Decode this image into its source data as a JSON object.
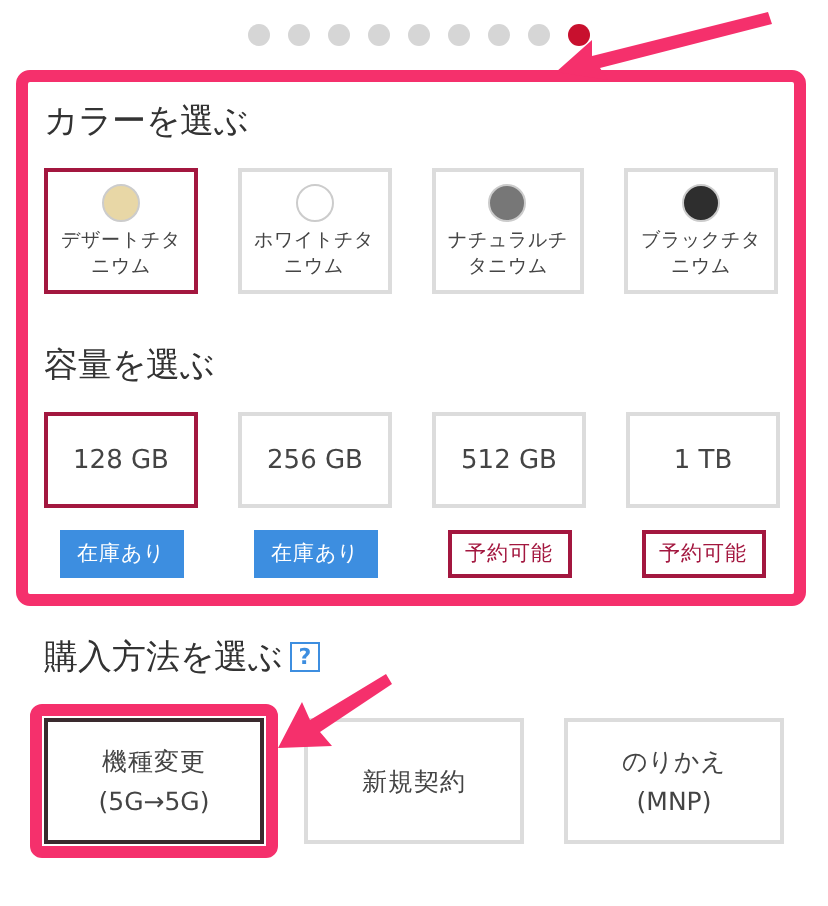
{
  "pager": [
    {
      "selected": false
    },
    {
      "selected": false
    },
    {
      "selected": false
    },
    {
      "selected": false
    },
    {
      "selected": false
    },
    {
      "selected": false
    },
    {
      "selected": false
    },
    {
      "selected": false
    },
    {
      "selected": true
    }
  ],
  "color_section": {
    "title": "カラーを選ぶ",
    "highlighted": true,
    "options": [
      {
        "label": "デザートチタニウム",
        "color": "#e8d7a6",
        "selected": true
      },
      {
        "label": "ホワイトチタニウム",
        "color": "#ffffff",
        "selected": false
      },
      {
        "label": "ナチュラルチタニウム",
        "color": "#777777",
        "selected": false
      },
      {
        "label": "ブラックチタニウム",
        "color": "#2e2e2e",
        "selected": false
      }
    ]
  },
  "capacity_section": {
    "title": "容量を選ぶ",
    "options": [
      {
        "label": "128 GB",
        "selected": true,
        "stock": {
          "kind": "in_stock",
          "label": "在庫あり"
        }
      },
      {
        "label": "256 GB",
        "selected": false,
        "stock": {
          "kind": "in_stock",
          "label": "在庫あり"
        }
      },
      {
        "label": "512 GB",
        "selected": false,
        "stock": {
          "kind": "reservable",
          "label": "予約可能"
        }
      },
      {
        "label": "1 TB",
        "selected": false,
        "stock": {
          "kind": "reservable",
          "label": "予約可能"
        }
      }
    ]
  },
  "purchase_section": {
    "title": "購入方法を選ぶ",
    "help": "?",
    "options": [
      {
        "lines": [
          "機種変更",
          "(5G→5G)"
        ],
        "selected": true,
        "highlighted": true
      },
      {
        "lines": [
          "新規契約"
        ],
        "selected": false,
        "highlighted": false
      },
      {
        "lines": [
          "のりかえ",
          "(MNP)"
        ],
        "selected": false,
        "highlighted": false
      }
    ]
  }
}
